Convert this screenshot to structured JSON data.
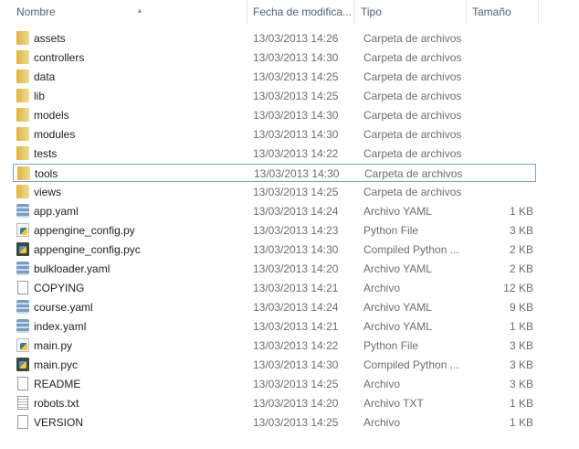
{
  "columns": {
    "name": "Nombre",
    "date": "Fecha de modifica...",
    "type": "Tipo",
    "size": "Tamaño"
  },
  "focused_item": "tools",
  "files": [
    {
      "name": "assets",
      "date": "13/03/2013 14:26",
      "type": "Carpeta de archivos",
      "size": "",
      "icon": "folder"
    },
    {
      "name": "controllers",
      "date": "13/03/2013 14:30",
      "type": "Carpeta de archivos",
      "size": "",
      "icon": "folder"
    },
    {
      "name": "data",
      "date": "13/03/2013 14:25",
      "type": "Carpeta de archivos",
      "size": "",
      "icon": "folder"
    },
    {
      "name": "lib",
      "date": "13/03/2013 14:25",
      "type": "Carpeta de archivos",
      "size": "",
      "icon": "folder"
    },
    {
      "name": "models",
      "date": "13/03/2013 14:30",
      "type": "Carpeta de archivos",
      "size": "",
      "icon": "folder"
    },
    {
      "name": "modules",
      "date": "13/03/2013 14:30",
      "type": "Carpeta de archivos",
      "size": "",
      "icon": "folder"
    },
    {
      "name": "tests",
      "date": "13/03/2013 14:22",
      "type": "Carpeta de archivos",
      "size": "",
      "icon": "folder"
    },
    {
      "name": "tools",
      "date": "13/03/2013 14:30",
      "type": "Carpeta de archivos",
      "size": "",
      "icon": "folder"
    },
    {
      "name": "views",
      "date": "13/03/2013 14:25",
      "type": "Carpeta de archivos",
      "size": "",
      "icon": "folder"
    },
    {
      "name": "app.yaml",
      "date": "13/03/2013 14:24",
      "type": "Archivo YAML",
      "size": "1 KB",
      "icon": "yaml"
    },
    {
      "name": "appengine_config.py",
      "date": "13/03/2013 14:23",
      "type": "Python File",
      "size": "3 KB",
      "icon": "py"
    },
    {
      "name": "appengine_config.pyc",
      "date": "13/03/2013 14:30",
      "type": "Compiled Python ...",
      "size": "2 KB",
      "icon": "pyc"
    },
    {
      "name": "bulkloader.yaml",
      "date": "13/03/2013 14:20",
      "type": "Archivo YAML",
      "size": "2 KB",
      "icon": "yaml"
    },
    {
      "name": "COPYING",
      "date": "13/03/2013 14:21",
      "type": "Archivo",
      "size": "12 KB",
      "icon": "file"
    },
    {
      "name": "course.yaml",
      "date": "13/03/2013 14:24",
      "type": "Archivo YAML",
      "size": "9 KB",
      "icon": "yaml"
    },
    {
      "name": "index.yaml",
      "date": "13/03/2013 14:21",
      "type": "Archivo YAML",
      "size": "1 KB",
      "icon": "yaml"
    },
    {
      "name": "main.py",
      "date": "13/03/2013 14:22",
      "type": "Python File",
      "size": "3 KB",
      "icon": "py"
    },
    {
      "name": "main.pyc",
      "date": "13/03/2013 14:30",
      "type": "Compiled Python ...",
      "size": "3 KB",
      "icon": "pyc"
    },
    {
      "name": "README",
      "date": "13/03/2013 14:25",
      "type": "Archivo",
      "size": "3 KB",
      "icon": "file"
    },
    {
      "name": "robots.txt",
      "date": "13/03/2013 14:20",
      "type": "Archivo TXT",
      "size": "1 KB",
      "icon": "txt"
    },
    {
      "name": "VERSION",
      "date": "13/03/2013 14:25",
      "type": "Archivo",
      "size": "1 KB",
      "icon": "file"
    }
  ]
}
